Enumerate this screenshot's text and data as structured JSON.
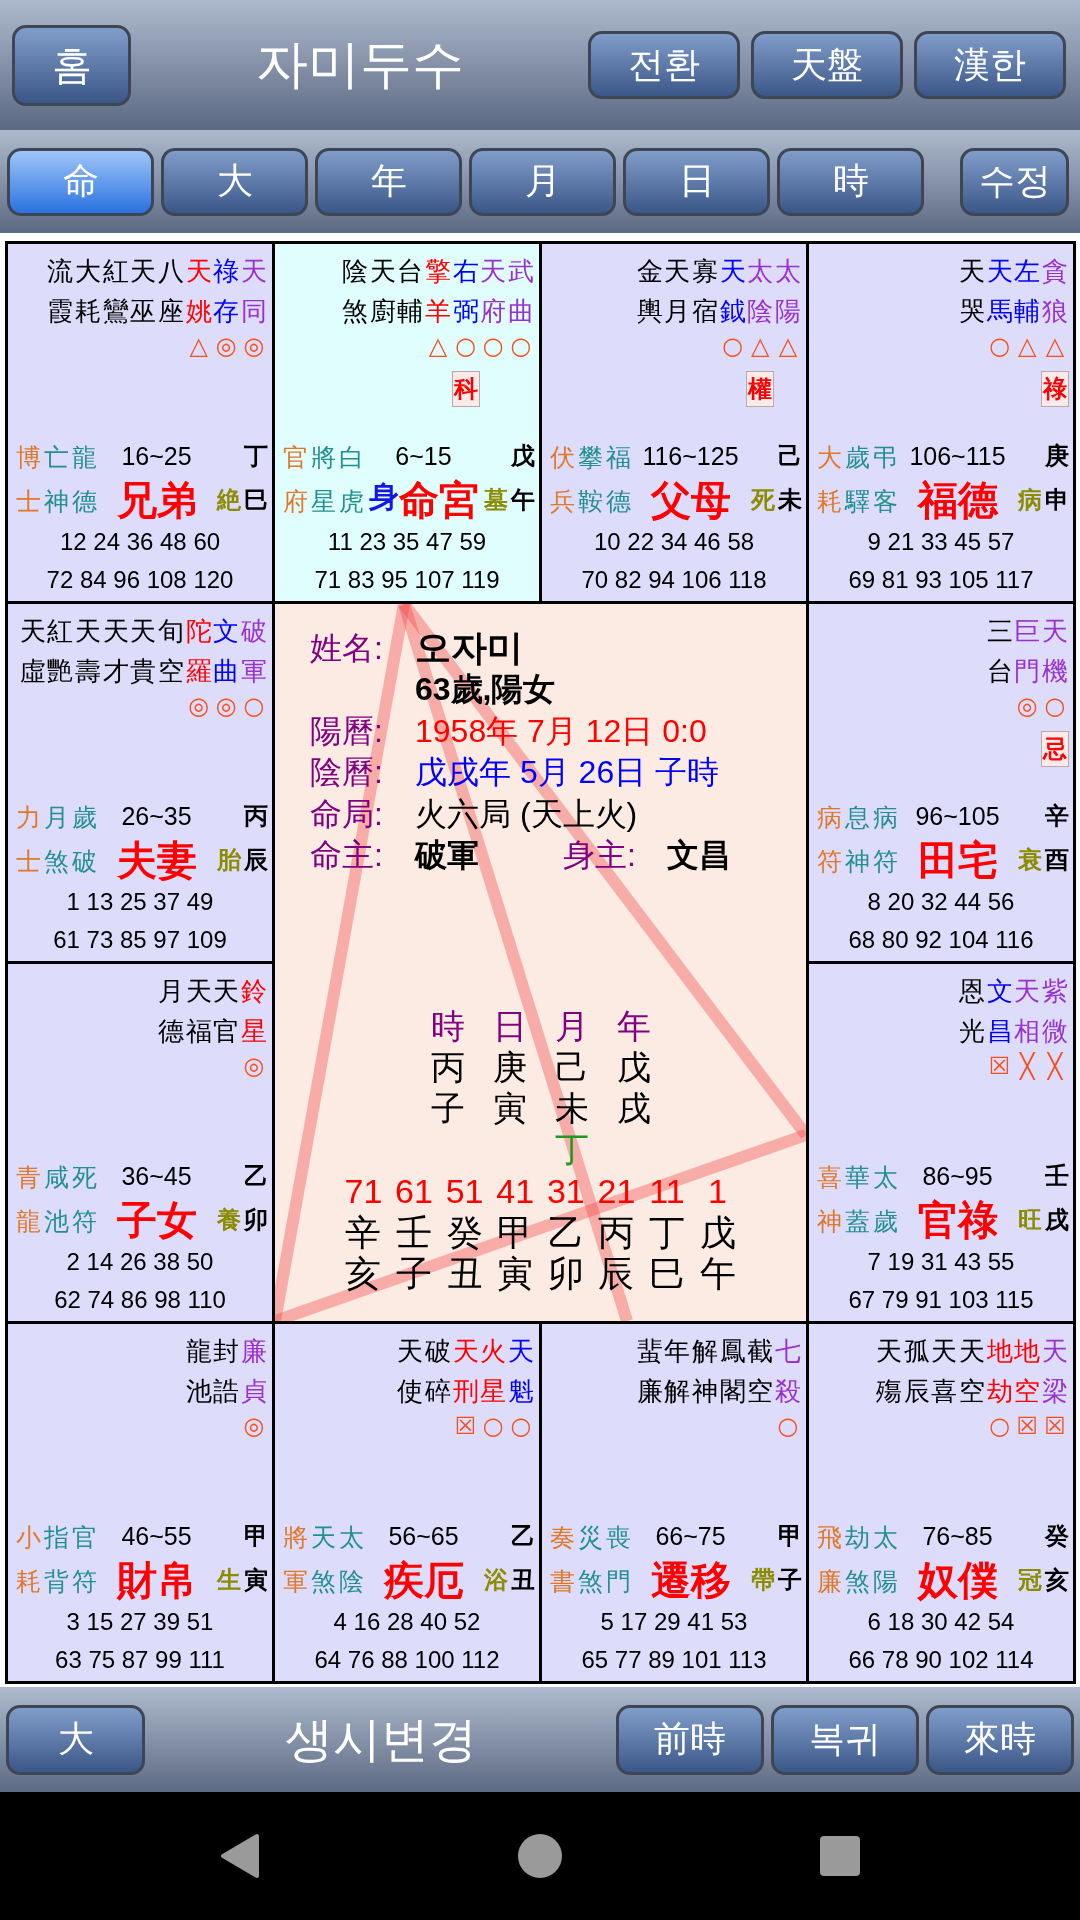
{
  "header": {
    "home_button": "홈",
    "title": "자미두수",
    "buttons": [
      "전환",
      "天盤",
      "漢한"
    ]
  },
  "tabs": [
    {
      "label": "命",
      "selected": true
    },
    {
      "label": "大",
      "selected": false
    },
    {
      "label": "年",
      "selected": false
    },
    {
      "label": "月",
      "selected": false
    },
    {
      "label": "日",
      "selected": false
    },
    {
      "label": "時",
      "selected": false
    }
  ],
  "edit_button": "수정",
  "palaces": [
    {
      "name": "兄弟",
      "selected": false,
      "age_range": "16~25",
      "stem": "丁",
      "branch": "巳",
      "stage": "絶",
      "stars": [
        {
          "name": "流霞",
          "color": "#000000"
        },
        {
          "name": "大耗",
          "color": "#000000"
        },
        {
          "name": "紅鸞",
          "color": "#000000"
        },
        {
          "name": "天巫",
          "color": "#000000"
        },
        {
          "name": "八座",
          "color": "#000000"
        },
        {
          "name": "天姚",
          "color": "#ff0000",
          "brightness": "△"
        },
        {
          "name": "祿存",
          "color": "#0000ff",
          "brightness": "◎"
        },
        {
          "name": "天同",
          "color": "#9932cc",
          "brightness": "◎"
        }
      ],
      "minor_stars": [
        {
          "name": "博士",
          "color": "#e0782a"
        },
        {
          "name": "亡神",
          "color": "#22908f"
        },
        {
          "name": "龍德",
          "color": "#22908f"
        }
      ],
      "years": [
        "12 24 36 48 60",
        "72 84 96 108 120"
      ]
    },
    {
      "name": "命宮",
      "selected": true,
      "body_marker": "身",
      "age_range": "6~15",
      "stem": "戊",
      "branch": "午",
      "stage": "墓",
      "stars": [
        {
          "name": "陰煞",
          "color": "#000000"
        },
        {
          "name": "天廚",
          "color": "#000000"
        },
        {
          "name": "台輔",
          "color": "#000000"
        },
        {
          "name": "擎羊",
          "color": "#ff0000",
          "brightness": "△"
        },
        {
          "name": "右弼",
          "color": "#0000ff",
          "brightness": "○",
          "transformation": "科"
        },
        {
          "name": "天府",
          "color": "#9932cc",
          "brightness": "○"
        },
        {
          "name": "武曲",
          "color": "#9932cc",
          "brightness": "○"
        }
      ],
      "minor_stars": [
        {
          "name": "官府",
          "color": "#e0782a"
        },
        {
          "name": "將星",
          "color": "#22908f"
        },
        {
          "name": "白虎",
          "color": "#22908f"
        }
      ],
      "years": [
        "11 23 35 47 59",
        "71 83 95 107 119"
      ]
    },
    {
      "name": "父母",
      "selected": false,
      "age_range": "116~125",
      "stem": "己",
      "branch": "未",
      "stage": "死",
      "stars": [
        {
          "name": "金輿",
          "color": "#000000"
        },
        {
          "name": "天月",
          "color": "#000000"
        },
        {
          "name": "寡宿",
          "color": "#000000"
        },
        {
          "name": "天鉞",
          "color": "#0000ff",
          "brightness": "○"
        },
        {
          "name": "太陰",
          "color": "#9932cc",
          "brightness": "△",
          "transformation": "權"
        },
        {
          "name": "太陽",
          "color": "#9932cc",
          "brightness": "△"
        }
      ],
      "minor_stars": [
        {
          "name": "伏兵",
          "color": "#e0782a"
        },
        {
          "name": "攀鞍",
          "color": "#22908f"
        },
        {
          "name": "福德",
          "color": "#22908f"
        }
      ],
      "years": [
        "10 22 34 46 58",
        "70 82 94 106 118"
      ]
    },
    {
      "name": "福德",
      "selected": false,
      "age_range": "106~115",
      "stem": "庚",
      "branch": "申",
      "stage": "病",
      "stars": [
        {
          "name": "天哭",
          "color": "#000000"
        },
        {
          "name": "天馬",
          "color": "#0000ff",
          "brightness": "○"
        },
        {
          "name": "左輔",
          "color": "#0000ff",
          "brightness": "△"
        },
        {
          "name": "貪狼",
          "color": "#9932cc",
          "brightness": "△",
          "transformation": "祿"
        }
      ],
      "minor_stars": [
        {
          "name": "大耗",
          "color": "#e0782a"
        },
        {
          "name": "歲驛",
          "color": "#22908f"
        },
        {
          "name": "弔客",
          "color": "#22908f"
        }
      ],
      "years": [
        "9 21 33 45 57",
        "69 81 93 105 117"
      ]
    },
    {
      "name": "夫妻",
      "selected": false,
      "age_range": "26~35",
      "stem": "丙",
      "branch": "辰",
      "stage": "胎",
      "stars": [
        {
          "name": "天虛",
          "color": "#000000"
        },
        {
          "name": "紅艷",
          "color": "#000000"
        },
        {
          "name": "天壽",
          "color": "#000000"
        },
        {
          "name": "天才",
          "color": "#000000"
        },
        {
          "name": "天貴",
          "color": "#000000"
        },
        {
          "name": "旬空",
          "color": "#000000"
        },
        {
          "name": "陀羅",
          "color": "#ff0000",
          "brightness": "◎"
        },
        {
          "name": "文曲",
          "color": "#0000ff",
          "brightness": "◎"
        },
        {
          "name": "破軍",
          "color": "#9932cc",
          "brightness": "○"
        }
      ],
      "minor_stars": [
        {
          "name": "力士",
          "color": "#e0782a"
        },
        {
          "name": "月煞",
          "color": "#22908f"
        },
        {
          "name": "歲破",
          "color": "#22908f"
        }
      ],
      "years": [
        "1 13 25 37 49",
        "61 73 85 97 109"
      ]
    },
    {
      "name": "田宅",
      "selected": false,
      "age_range": "96~105",
      "stem": "辛",
      "branch": "酉",
      "stage": "衰",
      "stars": [
        {
          "name": "三台",
          "color": "#000000"
        },
        {
          "name": "巨門",
          "color": "#9932cc",
          "brightness": "◎"
        },
        {
          "name": "天機",
          "color": "#9932cc",
          "brightness": "○",
          "transformation": "忌"
        }
      ],
      "minor_stars": [
        {
          "name": "病符",
          "color": "#e0782a"
        },
        {
          "name": "息神",
          "color": "#22908f"
        },
        {
          "name": "病符",
          "color": "#22908f"
        }
      ],
      "years": [
        "8 20 32 44 56",
        "68 80 92 104 116"
      ]
    },
    {
      "name": "子女",
      "selected": false,
      "age_range": "36~45",
      "stem": "乙",
      "branch": "卯",
      "stage": "養",
      "stars": [
        {
          "name": "月德",
          "color": "#000000"
        },
        {
          "name": "天福",
          "color": "#000000"
        },
        {
          "name": "天官",
          "color": "#000000"
        },
        {
          "name": "鈴星",
          "color": "#ff0000",
          "brightness": "◎"
        }
      ],
      "minor_stars": [
        {
          "name": "青龍",
          "color": "#e0782a"
        },
        {
          "name": "咸池",
          "color": "#22908f"
        },
        {
          "name": "死符",
          "color": "#22908f"
        }
      ],
      "years": [
        "2 14 26 38 50",
        "62 74 86 98 110"
      ]
    },
    {
      "name": "官祿",
      "selected": false,
      "age_range": "86~95",
      "stem": "壬",
      "branch": "戌",
      "stage": "旺",
      "stars": [
        {
          "name": "恩光",
          "color": "#000000"
        },
        {
          "name": "文昌",
          "color": "#0000ff",
          "brightness": "☒"
        },
        {
          "name": "天相",
          "color": "#9932cc",
          "brightness": "╳"
        },
        {
          "name": "紫微",
          "color": "#9932cc",
          "brightness": "╳"
        }
      ],
      "minor_stars": [
        {
          "name": "喜神",
          "color": "#e0782a"
        },
        {
          "name": "華蓋",
          "color": "#22908f"
        },
        {
          "name": "太歲",
          "color": "#22908f"
        }
      ],
      "years": [
        "7 19 31 43 55",
        "67 79 91 103 115"
      ]
    },
    {
      "name": "財帛",
      "selected": false,
      "age_range": "46~55",
      "stem": "甲",
      "branch": "寅",
      "stage": "生",
      "stars": [
        {
          "name": "龍池",
          "color": "#000000"
        },
        {
          "name": "封誥",
          "color": "#000000"
        },
        {
          "name": "廉貞",
          "color": "#9932cc",
          "brightness": "◎"
        }
      ],
      "minor_stars": [
        {
          "name": "小耗",
          "color": "#e0782a"
        },
        {
          "name": "指背",
          "color": "#22908f"
        },
        {
          "name": "官符",
          "color": "#22908f"
        }
      ],
      "years": [
        "3 15 27 39 51",
        "63 75 87 99 111"
      ]
    },
    {
      "name": "疾厄",
      "selected": false,
      "age_range": "56~65",
      "stem": "乙",
      "branch": "丑",
      "stage": "浴",
      "stars": [
        {
          "name": "天使",
          "color": "#000000"
        },
        {
          "name": "破碎",
          "color": "#000000"
        },
        {
          "name": "天刑",
          "color": "#ff0000",
          "brightness": "☒"
        },
        {
          "name": "火星",
          "color": "#ff0000",
          "brightness": "○"
        },
        {
          "name": "天魁",
          "color": "#0000ff",
          "brightness": "○"
        }
      ],
      "minor_stars": [
        {
          "name": "將軍",
          "color": "#e0782a"
        },
        {
          "name": "天煞",
          "color": "#22908f"
        },
        {
          "name": "太陰",
          "color": "#22908f"
        }
      ],
      "years": [
        "4 16 28 40 52",
        "64 76 88 100 112"
      ]
    },
    {
      "name": "遷移",
      "selected": false,
      "age_range": "66~75",
      "stem": "甲",
      "branch": "子",
      "stage": "帶",
      "stars": [
        {
          "name": "蜚廉",
          "color": "#000000"
        },
        {
          "name": "年解",
          "color": "#000000"
        },
        {
          "name": "解神",
          "color": "#000000"
        },
        {
          "name": "鳳閣",
          "color": "#000000"
        },
        {
          "name": "截空",
          "color": "#000000"
        },
        {
          "name": "七殺",
          "color": "#9932cc",
          "brightness": "○"
        }
      ],
      "minor_stars": [
        {
          "name": "奏書",
          "color": "#e0782a"
        },
        {
          "name": "災煞",
          "color": "#22908f"
        },
        {
          "name": "喪門",
          "color": "#22908f"
        }
      ],
      "years": [
        "5 17 29 41 53",
        "65 77 89 101 113"
      ]
    },
    {
      "name": "奴僕",
      "selected": false,
      "age_range": "76~85",
      "stem": "癸",
      "branch": "亥",
      "stage": "冠",
      "stars": [
        {
          "name": "天殤",
          "color": "#000000"
        },
        {
          "name": "孤辰",
          "color": "#000000"
        },
        {
          "name": "天喜",
          "color": "#000000"
        },
        {
          "name": "天空",
          "color": "#000000"
        },
        {
          "name": "地劫",
          "color": "#ff0000",
          "brightness": "○"
        },
        {
          "name": "地空",
          "color": "#ff0000",
          "brightness": "☒"
        },
        {
          "name": "天梁",
          "color": "#9932cc",
          "brightness": "☒"
        }
      ],
      "minor_stars": [
        {
          "name": "飛廉",
          "color": "#e0782a"
        },
        {
          "name": "劫煞",
          "color": "#22908f"
        },
        {
          "name": "太陽",
          "color": "#22908f"
        }
      ],
      "years": [
        "6 18 30 42 54",
        "66 78 90 102 114"
      ]
    }
  ],
  "center": {
    "name_label": "姓名:",
    "name": "오자미",
    "age_gender": "63歲,陽女",
    "rows": [
      {
        "label": "陽曆:",
        "value": "1958年 7月 12日 0:0",
        "color": "#ff0000"
      },
      {
        "label": "陰曆:",
        "value": "戊戌年 5月 26日 子時",
        "color": "#0000ff"
      },
      {
        "label": "命局:",
        "value": "火六局 (天上火)",
        "color": "#000000"
      }
    ],
    "masters": [
      {
        "label": "命主:",
        "value": "破軍"
      },
      {
        "label": "身主:",
        "value": "文昌"
      }
    ],
    "pillars": [
      {
        "label": "時",
        "stem": "丙",
        "branch": "子"
      },
      {
        "label": "日",
        "stem": "庚",
        "branch": "寅"
      },
      {
        "label": "月",
        "stem": "己",
        "branch": "未",
        "extra_stem": "丁"
      },
      {
        "label": "年",
        "stem": "戊",
        "branch": "戌"
      }
    ],
    "decades": [
      {
        "age": "71",
        "stem": "辛",
        "branch": "亥"
      },
      {
        "age": "61",
        "stem": "壬",
        "branch": "子"
      },
      {
        "age": "51",
        "stem": "癸",
        "branch": "丑"
      },
      {
        "age": "41",
        "stem": "甲",
        "branch": "寅"
      },
      {
        "age": "31",
        "stem": "乙",
        "branch": "卯"
      },
      {
        "age": "21",
        "stem": "丙",
        "branch": "辰"
      },
      {
        "age": "11",
        "stem": "丁",
        "branch": "巳"
      },
      {
        "age": "1",
        "stem": "戊",
        "branch": "午"
      }
    ]
  },
  "footer": {
    "left_button": "大",
    "title": "생시변경",
    "buttons": [
      "前時",
      "복귀",
      "來時"
    ]
  }
}
